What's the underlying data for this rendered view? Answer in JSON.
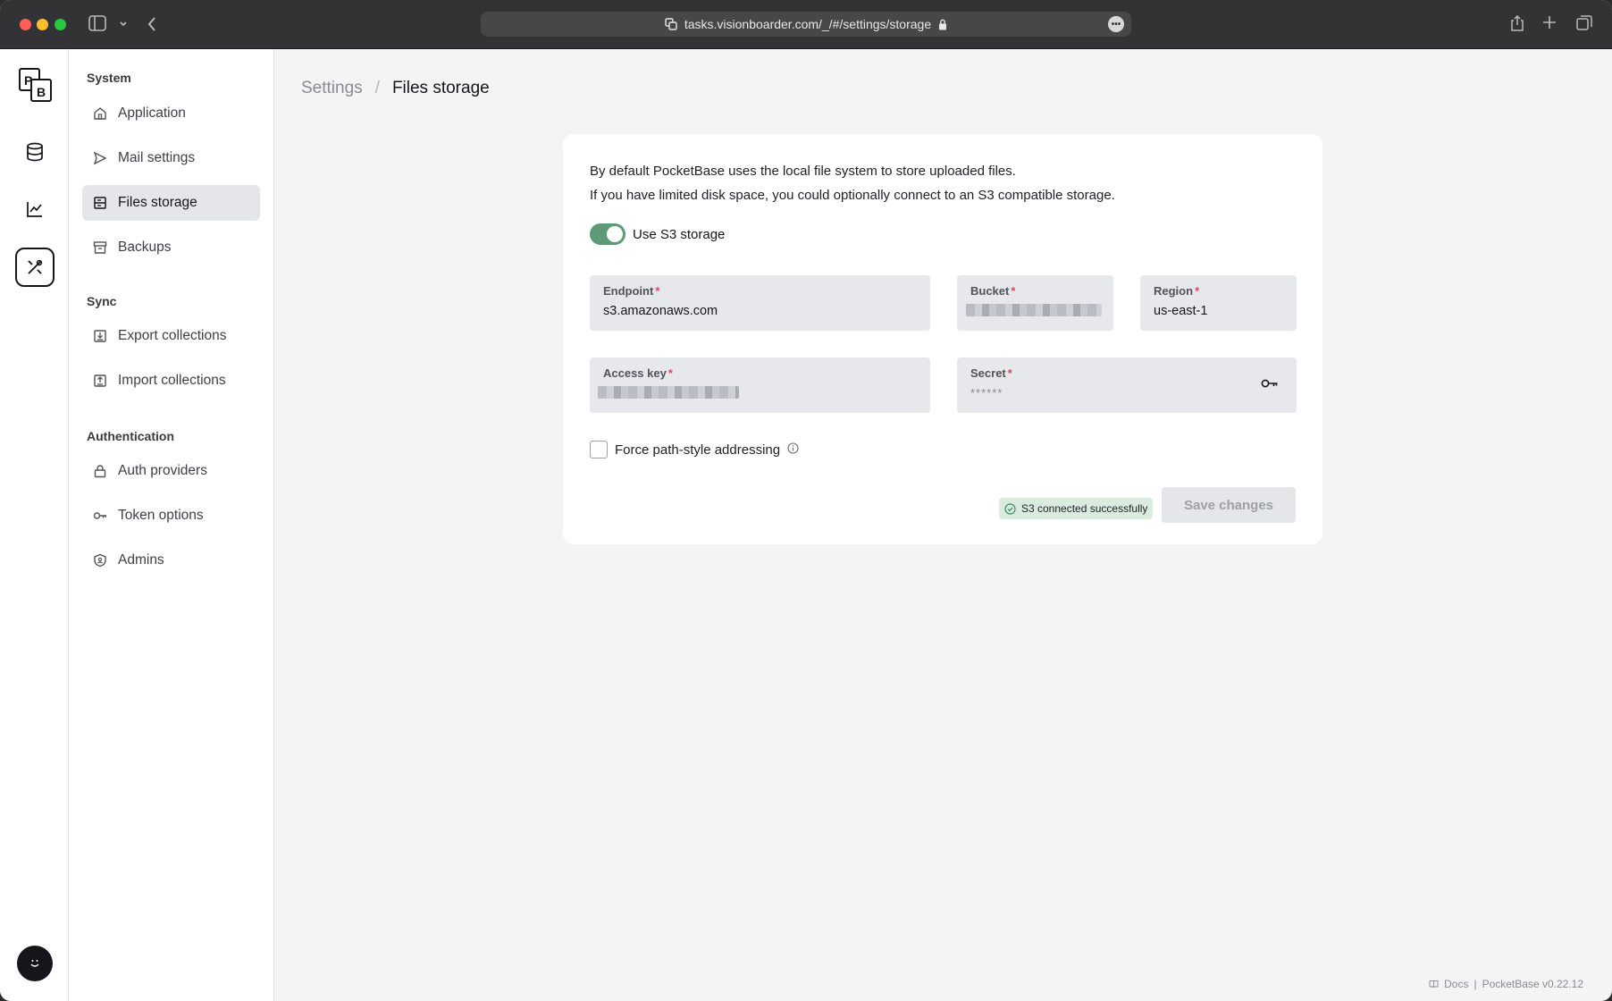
{
  "browser": {
    "url": "tasks.visionboarder.com/_/#/settings/storage"
  },
  "sidebar": {
    "sections": [
      {
        "title": "System",
        "items": [
          {
            "label": "Application",
            "icon": "home-icon"
          },
          {
            "label": "Mail settings",
            "icon": "send-icon"
          },
          {
            "label": "Files storage",
            "icon": "storage-icon",
            "active": true
          },
          {
            "label": "Backups",
            "icon": "archive-icon"
          }
        ]
      },
      {
        "title": "Sync",
        "items": [
          {
            "label": "Export collections",
            "icon": "export-icon"
          },
          {
            "label": "Import collections",
            "icon": "import-icon"
          }
        ]
      },
      {
        "title": "Authentication",
        "items": [
          {
            "label": "Auth providers",
            "icon": "lock-icon"
          },
          {
            "label": "Token options",
            "icon": "key-icon"
          },
          {
            "label": "Admins",
            "icon": "shield-icon"
          }
        ]
      }
    ]
  },
  "breadcrumb": {
    "root": "Settings",
    "separator": "/",
    "current": "Files storage"
  },
  "storage": {
    "description_line1": "By default PocketBase uses the local file system to store uploaded files.",
    "description_line2": "If you have limited disk space, you could optionally connect to an S3 compatible storage.",
    "use_s3_label": "Use S3 storage",
    "use_s3_enabled": true,
    "fields": {
      "endpoint": {
        "label": "Endpoint",
        "value": "s3.amazonaws.com"
      },
      "bucket": {
        "label": "Bucket"
      },
      "region": {
        "label": "Region",
        "value": "us-east-1"
      },
      "access_key": {
        "label": "Access key"
      },
      "secret": {
        "label": "Secret",
        "value": "******"
      }
    },
    "required_mark": "*",
    "force_path_label": "Force path-style addressing",
    "force_path_checked": false,
    "status_text": "S3 connected successfully",
    "save_label": "Save changes"
  },
  "footer": {
    "docs_label": "Docs",
    "separator": "|",
    "version": "PocketBase v0.22.12"
  },
  "colors": {
    "accent_toggle": "#5d9b76",
    "status_bg": "#d9ecdf",
    "required": "#e34562"
  }
}
